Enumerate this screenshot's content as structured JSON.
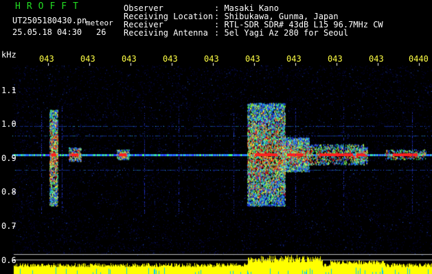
{
  "header": {
    "app_name": "HROFFT",
    "file_name": "UT2505180430.pn",
    "mode": "meteor",
    "date_time": "25.05.18 04:30",
    "count": "26",
    "fields": [
      {
        "label": "Observer",
        "value": ": Masaki Kano"
      },
      {
        "label": "Receiving Location",
        "value": ": Shibukawa, Gunma, Japan"
      },
      {
        "label": "Receiver",
        "value": ": RTL-SDR SDR# 43dB L15 96.7MHz CW"
      },
      {
        "label": "Receiving Antenna",
        "value": ": 5el Yagi Az 280 for Seoul"
      }
    ]
  },
  "axes": {
    "y_unit": "kHz",
    "y_ticks": [
      "1.1",
      "1.0",
      "0.9",
      "0.8",
      "0.7",
      "0.6"
    ],
    "x_ticks": [
      "043",
      "043",
      "043",
      "043",
      "043",
      "043",
      "043",
      "043",
      "043",
      "0440"
    ]
  },
  "colors": {
    "header_green": "#22dd22",
    "time_yellow": "#ffff44",
    "carrier_red": "#ff2020",
    "noise_blue": "#1020c0",
    "power_yellow": "#ffff00",
    "power_cyan": "#00c8ff"
  }
}
